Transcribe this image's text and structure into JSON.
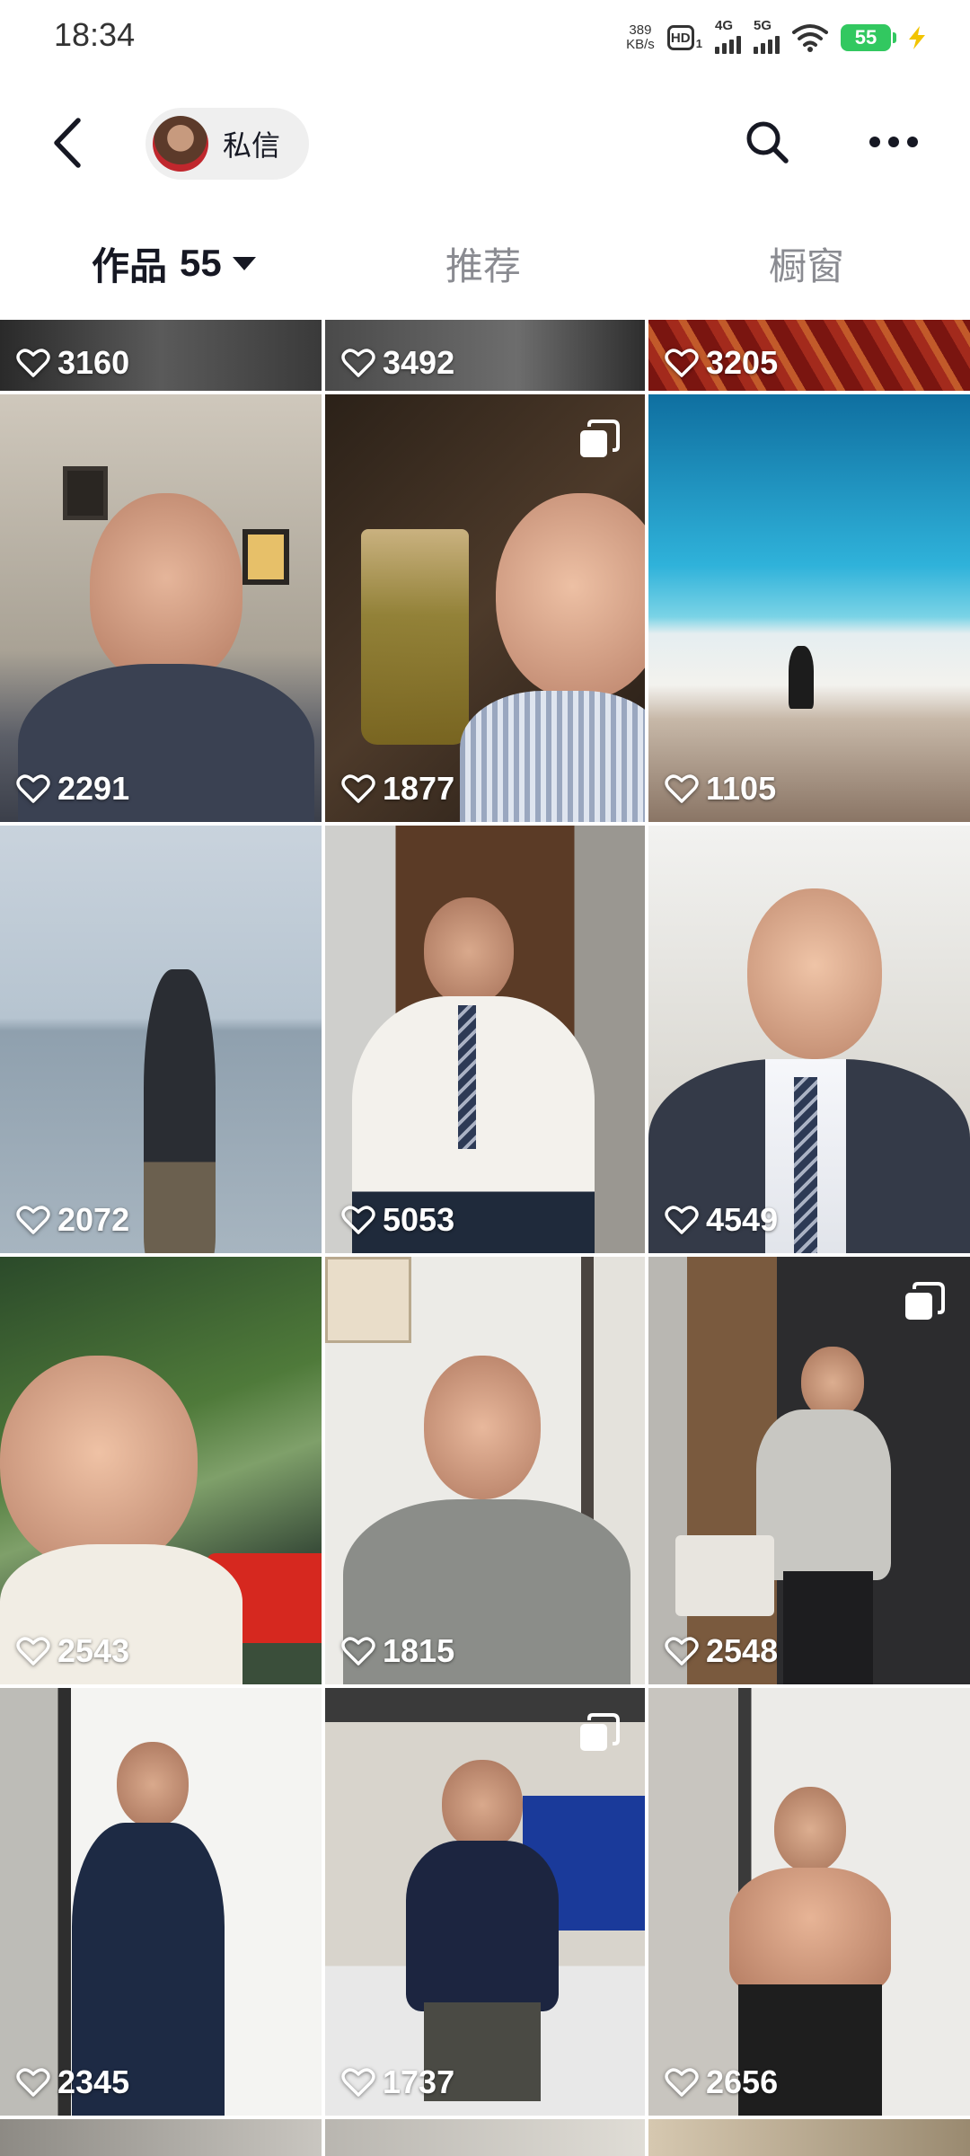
{
  "status_bar": {
    "time": "18:34",
    "net_speed_value": "389",
    "net_speed_unit": "KB/s",
    "hd_label": "HD",
    "hd_sub": "1",
    "sig1_label": "4G",
    "sig2_label": "5G",
    "battery": "55",
    "icons": [
      "hd-icon",
      "signal-4g-icon",
      "signal-5g-icon",
      "wifi-icon",
      "battery-icon",
      "charging-icon"
    ]
  },
  "topnav": {
    "message_label": "私信",
    "icons": [
      "back-icon",
      "avatar",
      "search-icon",
      "more-icon"
    ]
  },
  "tabs": [
    {
      "label": "作品",
      "count": "55",
      "active": true
    },
    {
      "label": "推荐",
      "active": false
    },
    {
      "label": "橱窗",
      "active": false
    }
  ],
  "grid": {
    "partial_row": [
      {
        "likes": "3160"
      },
      {
        "likes": "3492"
      },
      {
        "likes": "3205"
      }
    ],
    "rows": [
      [
        {
          "likes": "2291",
          "multi": false
        },
        {
          "likes": "1877",
          "multi": true
        },
        {
          "likes": "1105",
          "multi": false
        }
      ],
      [
        {
          "likes": "2072",
          "multi": false
        },
        {
          "likes": "5053",
          "multi": false
        },
        {
          "likes": "4549",
          "multi": false
        }
      ],
      [
        {
          "likes": "2543",
          "multi": false
        },
        {
          "likes": "1815",
          "multi": false
        },
        {
          "likes": "2548",
          "multi": true
        }
      ],
      [
        {
          "likes": "2345",
          "multi": false
        },
        {
          "likes": "1737",
          "multi": true
        },
        {
          "likes": "2656",
          "multi": false
        }
      ]
    ]
  },
  "colors": {
    "text_primary": "#161823",
    "text_secondary": "#8a8b91",
    "battery": "#32c860"
  }
}
